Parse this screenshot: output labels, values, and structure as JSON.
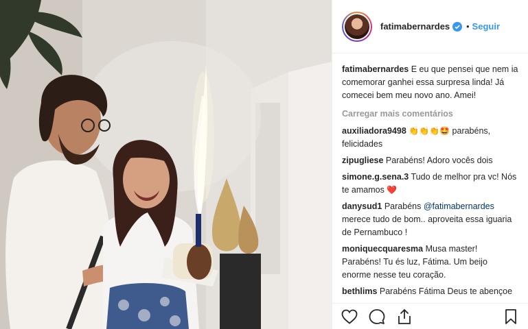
{
  "post": {
    "username": "fatimabernardes",
    "separator": "•",
    "follow_label": "Seguir",
    "avatar_icon": "profile-avatar",
    "verified_icon": "verified-badge-icon",
    "colors": {
      "link": "#3897f0",
      "text": "#262626",
      "muted": "#999999",
      "heart": "#ed4956"
    }
  },
  "caption": {
    "user": "fatimabernardes",
    "text": "E eu que pensei que nem ia comemorar ganhei essa surpresa linda! Já comecei bem meu novo ano. Amei!"
  },
  "load_more_label": "Carregar mais comentários",
  "comments": [
    {
      "user": "auxiliadora9498",
      "text_before": "👏👏👏🤩",
      "text": " parabéns, felicidades"
    },
    {
      "user": "zipugliese",
      "text": "Parabéns! Adoro vocês dois"
    },
    {
      "user": "simone.g.sena.3",
      "text": "Tudo de melhor pra vc! Nós te amamos ",
      "text_after": "❤️"
    },
    {
      "user": "danysud1",
      "text": "Parabéns ",
      "mention": "@fatimabernardes",
      "text_after": " merece tudo de bom.. aproveita essa iguaria de Pernambuco !"
    },
    {
      "user": "moniquecquaresma",
      "text": "Musa master! Parabéns! Tu és luz, Fátima. Um beijo enorme nesse teu coração."
    },
    {
      "user": "bethlims",
      "text": "Parabéns Fátima Deus te abençoe e te guarde em todos os dias da sua vida"
    }
  ],
  "actions": {
    "like_icon": "heart-icon",
    "comment_icon": "comment-icon",
    "share_icon": "share-icon",
    "save_icon": "bookmark-icon"
  }
}
